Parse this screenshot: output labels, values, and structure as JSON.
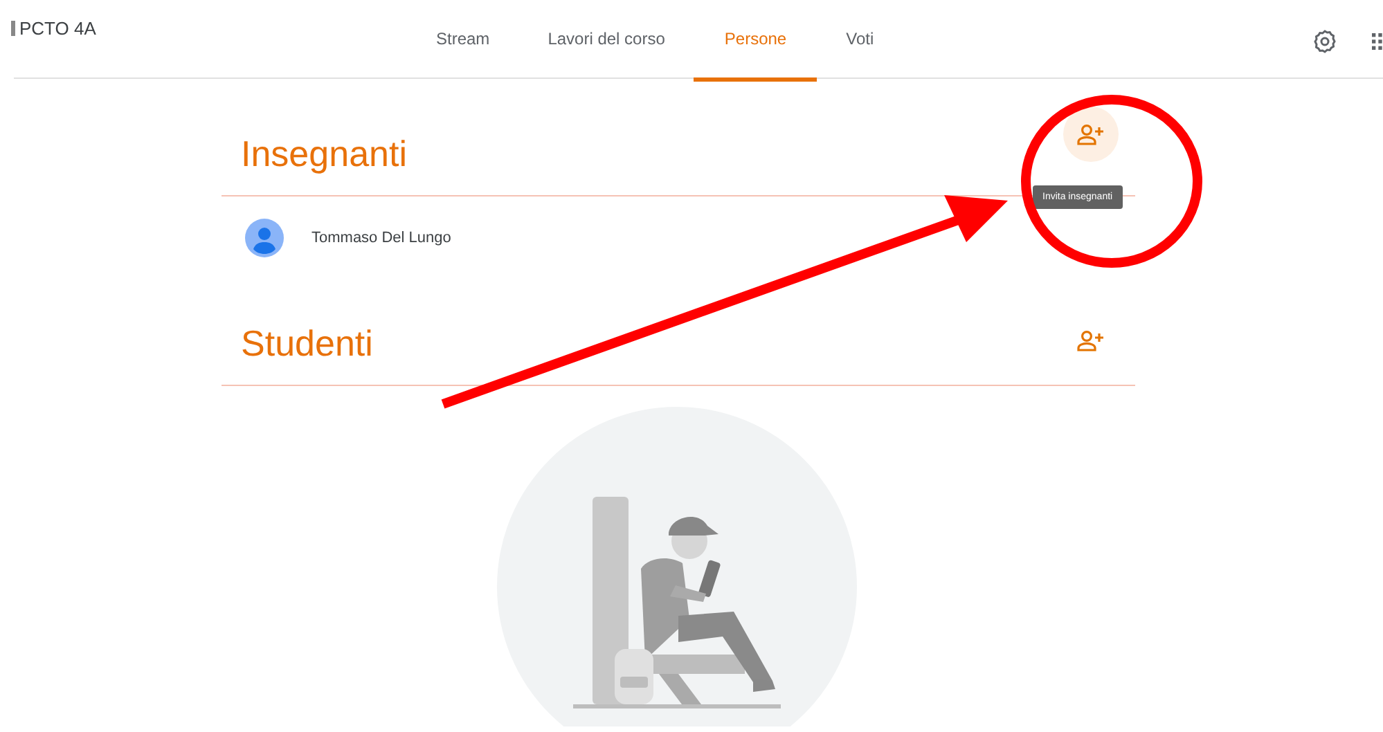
{
  "header": {
    "class_title": "PCTO 4A"
  },
  "tabs": [
    {
      "label": "Stream",
      "selected": false
    },
    {
      "label": "Lavori del corso",
      "selected": false
    },
    {
      "label": "Persone",
      "selected": true
    },
    {
      "label": "Voti",
      "selected": false
    }
  ],
  "sections": [
    {
      "heading": "Insegnanti",
      "invite_highlighted": true,
      "tooltip": "Invita insegnanti",
      "people": [
        {
          "name": "Tommaso Del Lungo"
        }
      ]
    },
    {
      "heading": "Studenti",
      "invite_highlighted": false
    }
  ]
}
